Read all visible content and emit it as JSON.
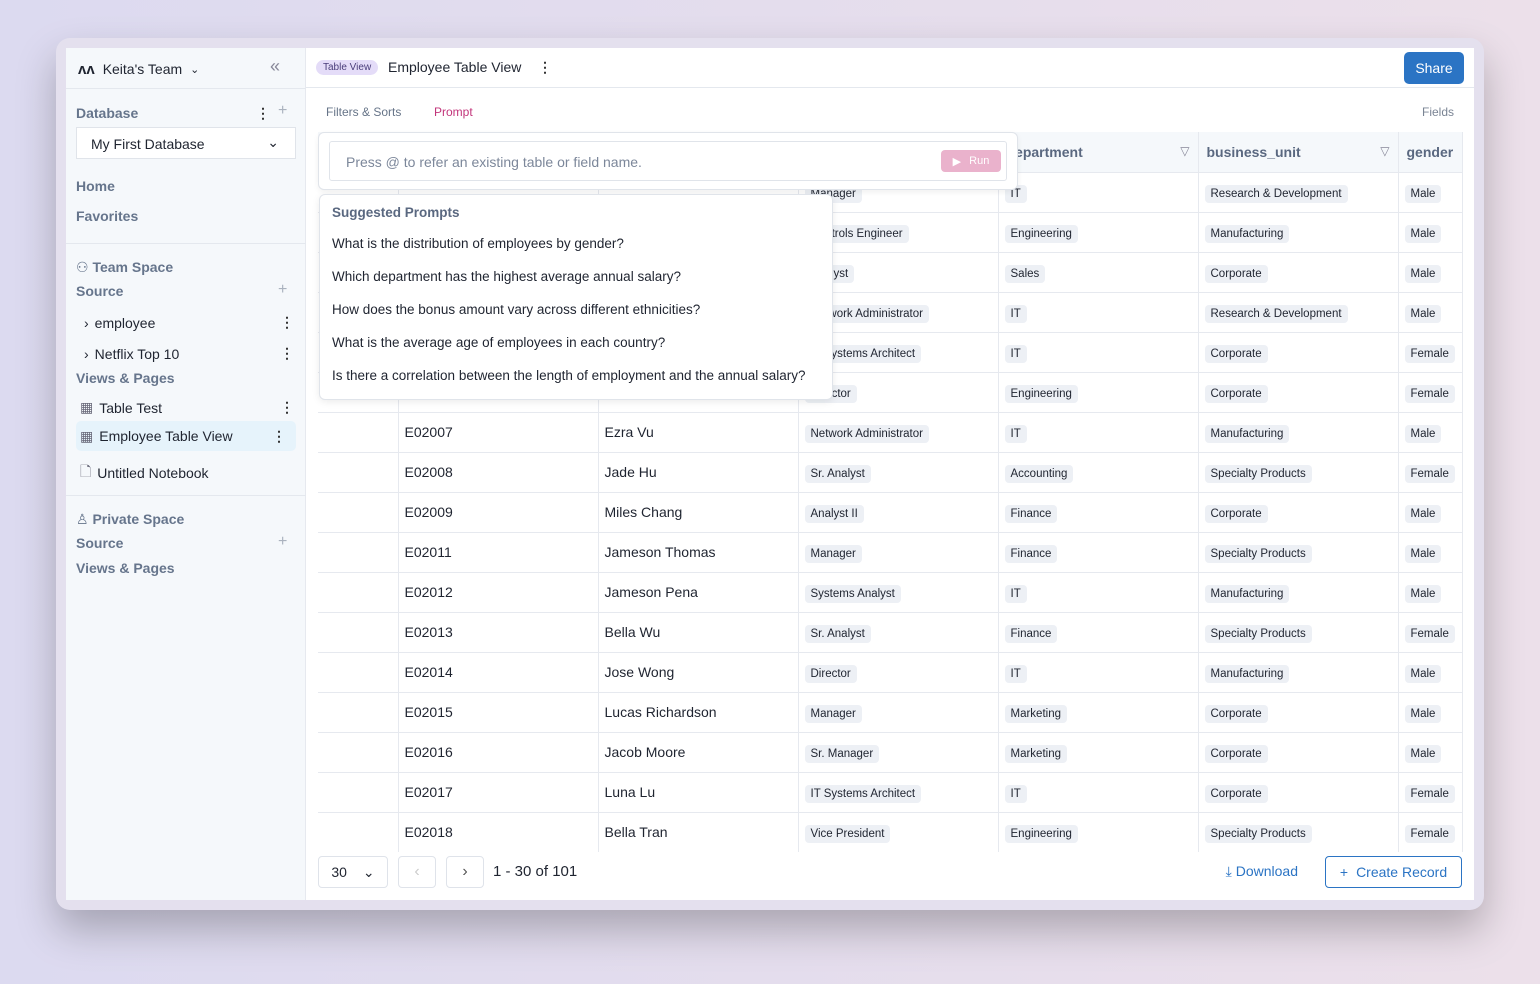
{
  "sidebar": {
    "team": "Keita's Team",
    "database_label": "Database",
    "database_select": "My First Database",
    "home": "Home",
    "favorites": "Favorites",
    "team_space": "Team Space",
    "source": "Source",
    "sources": [
      {
        "label": "employee"
      },
      {
        "label": "Netflix Top 10"
      }
    ],
    "views_pages": "Views & Pages",
    "views": [
      {
        "label": "Table Test",
        "icon": "table-icon"
      },
      {
        "label": "Employee Table View",
        "icon": "table-icon",
        "active": true
      },
      {
        "label": "Untitled Notebook",
        "icon": "document-icon"
      }
    ],
    "private_space": "Private Space",
    "private_source": "Source",
    "private_views": "Views & Pages"
  },
  "header": {
    "badge": "Table View",
    "title": "Employee Table View",
    "share": "Share"
  },
  "toolbar": {
    "filters": "Filters & Sorts",
    "prompt": "Prompt",
    "fields": "Fields"
  },
  "prompt": {
    "placeholder": "Press @ to refer an existing table or field name.",
    "run": "Run"
  },
  "suggested": {
    "title": "Suggested Prompts",
    "items": [
      "What is the distribution of employees by gender?",
      "Which department has the highest average annual salary?",
      "How does the bonus amount vary across different ethnicities?",
      "What is the average age of employees in each country?",
      "Is there a correlation between the length of employment and the annual salary?"
    ]
  },
  "table": {
    "columns": [
      "",
      "",
      "",
      "department",
      "business_unit",
      "gender"
    ],
    "rows": [
      [
        "",
        "",
        "Manager",
        "IT",
        "Research & Development",
        "Male"
      ],
      [
        "",
        "",
        "Controls Engineer",
        "Engineering",
        "Manufacturing",
        "Male"
      ],
      [
        "",
        "",
        "Analyst",
        "Sales",
        "Corporate",
        "Male"
      ],
      [
        "",
        "",
        "Network Administrator",
        "IT",
        "Research & Development",
        "Male"
      ],
      [
        "",
        "",
        "IT Systems Architect",
        "IT",
        "Corporate",
        "Female"
      ],
      [
        "",
        "",
        "Director",
        "Engineering",
        "Corporate",
        "Female"
      ],
      [
        "E02007",
        "Ezra Vu",
        "Network Administrator",
        "IT",
        "Manufacturing",
        "Male"
      ],
      [
        "E02008",
        "Jade Hu",
        "Sr. Analyst",
        "Accounting",
        "Specialty Products",
        "Female"
      ],
      [
        "E02009",
        "Miles Chang",
        "Analyst II",
        "Finance",
        "Corporate",
        "Male"
      ],
      [
        "E02011",
        "Jameson Thomas",
        "Manager",
        "Finance",
        "Specialty Products",
        "Male"
      ],
      [
        "E02012",
        "Jameson Pena",
        "Systems Analyst",
        "IT",
        "Manufacturing",
        "Male"
      ],
      [
        "E02013",
        "Bella Wu",
        "Sr. Analyst",
        "Finance",
        "Specialty Products",
        "Female"
      ],
      [
        "E02014",
        "Jose Wong",
        "Director",
        "IT",
        "Manufacturing",
        "Male"
      ],
      [
        "E02015",
        "Lucas Richardson",
        "Manager",
        "Marketing",
        "Corporate",
        "Male"
      ],
      [
        "E02016",
        "Jacob Moore",
        "Sr. Manager",
        "Marketing",
        "Corporate",
        "Male"
      ],
      [
        "E02017",
        "Luna Lu",
        "IT Systems Architect",
        "IT",
        "Corporate",
        "Female"
      ],
      [
        "E02018",
        "Bella Tran",
        "Vice President",
        "Engineering",
        "Specialty Products",
        "Female"
      ]
    ]
  },
  "footer": {
    "page_size": "30",
    "range": "1 - 30 of 101",
    "download": "Download",
    "create": "Create Record"
  },
  "colors": {
    "accent": "#2b74c4",
    "prompt_tab": "#c2347a",
    "run": "#eab2cc"
  }
}
